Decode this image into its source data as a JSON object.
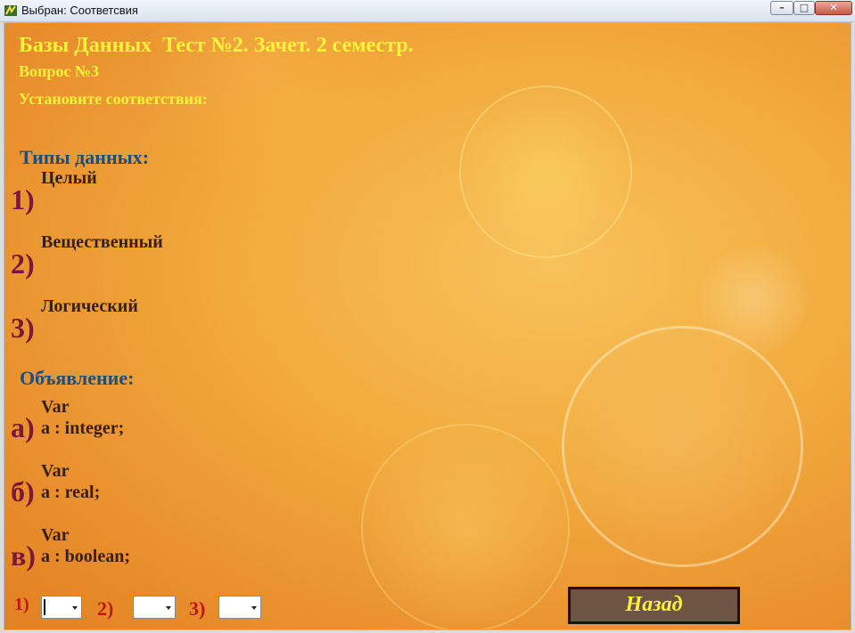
{
  "window": {
    "title": "Выбран: Соответсвия"
  },
  "header": {
    "title": "Базы Данных  Тест №2. Зачет. 2 семестр.",
    "question": "Вопрос №3",
    "instruction": "Установите соответствия:"
  },
  "types_section": {
    "heading": "Типы данных:",
    "items": [
      {
        "num": "1)",
        "label": "Целый"
      },
      {
        "num": "2)",
        "label": "Вещественный"
      },
      {
        "num": "3)",
        "label": "Логический"
      }
    ]
  },
  "decl_section": {
    "heading": "Объявление:",
    "items": [
      {
        "letter": "а)",
        "line1": "Var",
        "line2": "a : integer;"
      },
      {
        "letter": "б)",
        "line1": "Var",
        "line2": "a : real;"
      },
      {
        "letter": "в)",
        "line1": "Var",
        "line2": "a : boolean;"
      }
    ]
  },
  "answers": {
    "labels": [
      "1)",
      "2)",
      "3)"
    ],
    "selected": [
      "",
      "",
      ""
    ]
  },
  "buttons": {
    "back": "Назад"
  },
  "colors": {
    "header_text": "#fff23a",
    "section_heading": "#1f4e79",
    "number": "#7b1837",
    "answer_label": "#c01616",
    "button_bg": "#6e5543"
  }
}
